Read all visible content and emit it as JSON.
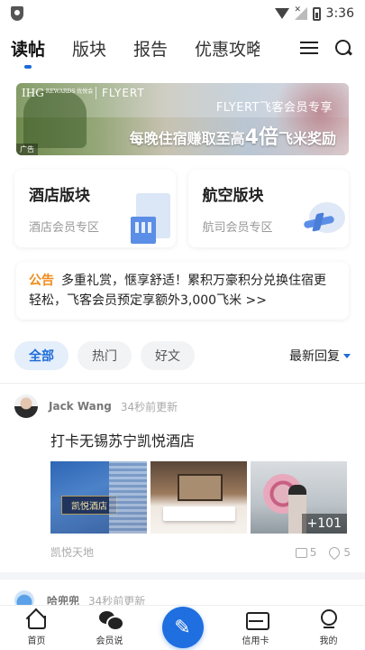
{
  "status_bar": {
    "time": "3:36"
  },
  "top_nav": {
    "tabs": [
      {
        "label": "读帖",
        "active": true
      },
      {
        "label": "版块",
        "active": false
      },
      {
        "label": "报告",
        "active": false
      },
      {
        "label": "优惠攻略",
        "active": false
      }
    ]
  },
  "banner": {
    "logo": "IHG",
    "logo_sub": "REWARDS 优悦会",
    "flyert": "FLYERT",
    "tag": "FLYERT飞客会员专享",
    "main_prefix": "每晚住宿赚取至高",
    "main_highlight": "4倍",
    "main_suffix": "飞米奖励",
    "ad_label": "广告"
  },
  "cards": [
    {
      "title": "酒店版块",
      "sub": "酒店会员专区"
    },
    {
      "title": "航空版块",
      "sub": "航司会员专区"
    }
  ],
  "notice": {
    "label": "公告",
    "text": "多重礼赏，惬享舒适！累积万豪积分兑换住宿更轻松，飞客会员预定享额外3,000飞米 >>"
  },
  "filter": {
    "chips": [
      {
        "label": "全部",
        "active": true
      },
      {
        "label": "热门",
        "active": false
      },
      {
        "label": "好文",
        "active": false
      }
    ],
    "sort_label": "最新回复"
  },
  "posts": [
    {
      "author": "Jack Wang",
      "updated": "34秒前更新",
      "title": "打卡无锡苏宁凯悦酒店",
      "more_photos": "+101",
      "forum": "凯悦天地",
      "comments": "5",
      "likes": "5"
    },
    {
      "author": "哈兜兜",
      "updated": "34秒前更新"
    }
  ],
  "bottom_nav": {
    "items": [
      {
        "label": "首页"
      },
      {
        "label": "会员说"
      },
      {
        "label": "信用卡"
      },
      {
        "label": "我的"
      }
    ]
  }
}
